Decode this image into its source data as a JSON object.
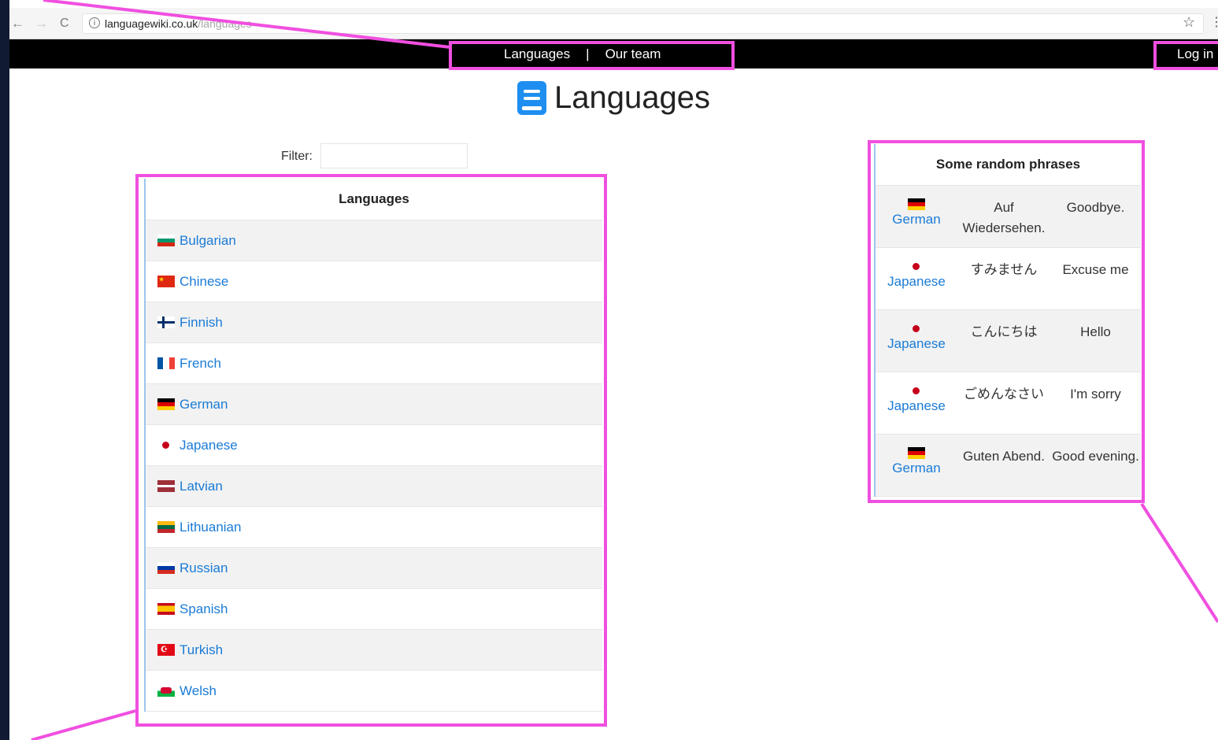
{
  "browser": {
    "url_host": "languagewiki.co.uk",
    "url_path": "/languages",
    "back": "←",
    "forward": "→",
    "reload": "C",
    "info": "i",
    "star": "☆",
    "menu": "⋮"
  },
  "nav": {
    "languages": "Languages",
    "separator": "|",
    "our_team": "Our team",
    "login": "Log in"
  },
  "page": {
    "title": "Languages",
    "filter_label": "Filter:",
    "filter_value": ""
  },
  "languages_table": {
    "header": "Languages",
    "rows": [
      {
        "name": "Bulgarian",
        "icon": "bulgaria-flag-icon"
      },
      {
        "name": "Chinese",
        "icon": "china-flag-icon"
      },
      {
        "name": "Finnish",
        "icon": "finland-flag-icon"
      },
      {
        "name": "French",
        "icon": "france-flag-icon"
      },
      {
        "name": "German",
        "icon": "germany-flag-icon"
      },
      {
        "name": "Japanese",
        "icon": "japan-flag-icon"
      },
      {
        "name": "Latvian",
        "icon": "latvia-flag-icon"
      },
      {
        "name": "Lithuanian",
        "icon": "lithuania-flag-icon"
      },
      {
        "name": "Russian",
        "icon": "russia-flag-icon"
      },
      {
        "name": "Spanish",
        "icon": "spain-flag-icon"
      },
      {
        "name": "Turkish",
        "icon": "turkey-flag-icon"
      },
      {
        "name": "Welsh",
        "icon": "wales-flag-icon"
      }
    ]
  },
  "phrases_table": {
    "header": "Some random phrases",
    "rows": [
      {
        "language": "German",
        "phrase": "Auf Wiedersehen.",
        "translation": "Goodbye."
      },
      {
        "language": "Japanese",
        "phrase": "すみません",
        "translation": "Excuse me"
      },
      {
        "language": "Japanese",
        "phrase": "こんにちは",
        "translation": "Hello"
      },
      {
        "language": "Japanese",
        "phrase": "ごめんなさい",
        "translation": "I'm sorry"
      },
      {
        "language": "German",
        "phrase": "Guten Abend.",
        "translation": "Good evening."
      }
    ]
  },
  "colors": {
    "highlight": "#f04fe0",
    "link": "#1a7bd6",
    "nav_bg": "#000000",
    "accent": "#1e8ff0"
  }
}
